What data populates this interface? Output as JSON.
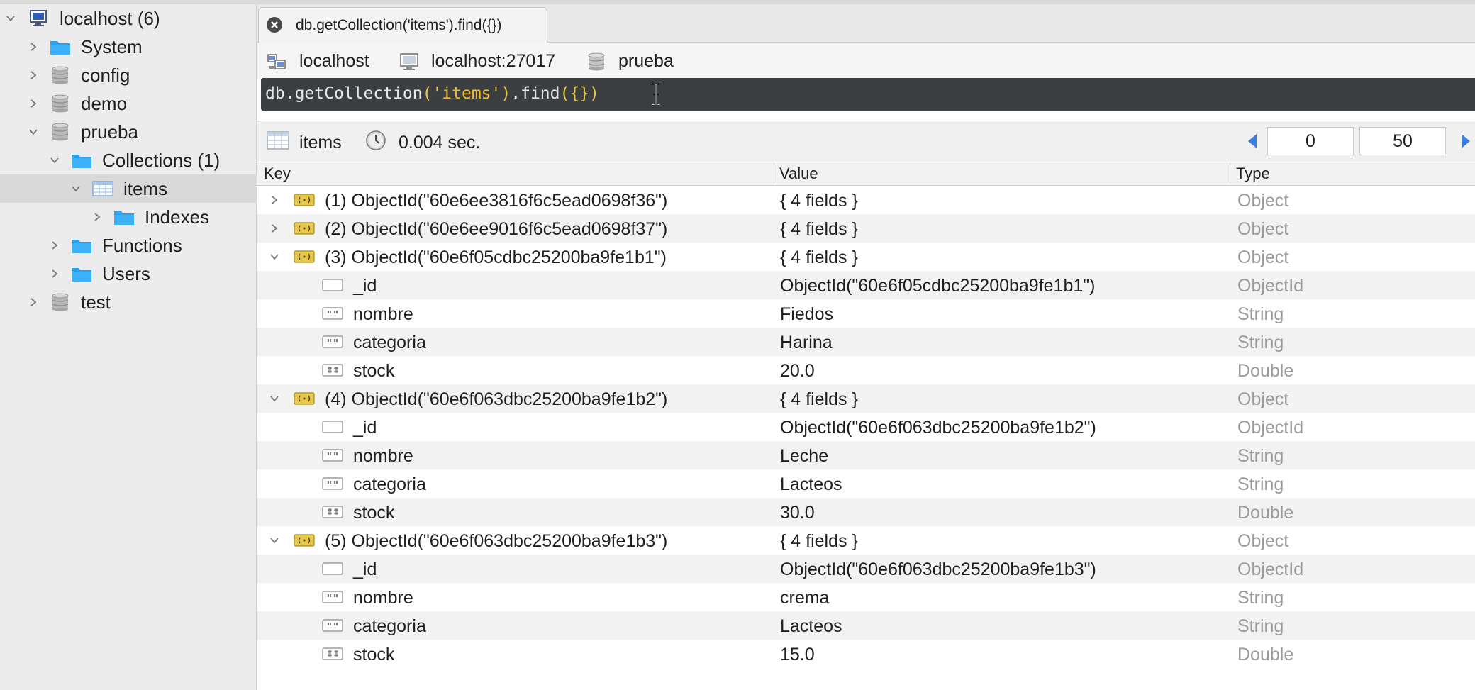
{
  "sidebar": {
    "items": [
      {
        "label": "localhost (6)",
        "icon": "server-icon"
      },
      {
        "label": "System",
        "icon": "folder-icon"
      },
      {
        "label": "config",
        "icon": "database-icon"
      },
      {
        "label": "demo",
        "icon": "database-icon"
      },
      {
        "label": "prueba",
        "icon": "database-icon"
      },
      {
        "label": "Collections (1)",
        "icon": "folder-icon"
      },
      {
        "label": "items",
        "icon": "collection-icon"
      },
      {
        "label": "Indexes",
        "icon": "folder-icon"
      },
      {
        "label": "Functions",
        "icon": "folder-icon"
      },
      {
        "label": "Users",
        "icon": "folder-icon"
      },
      {
        "label": "test",
        "icon": "database-icon"
      }
    ]
  },
  "tab": {
    "title": "db.getCollection('items').find({})"
  },
  "connection": {
    "host": "localhost",
    "server": "localhost:27017",
    "database": "prueba"
  },
  "query": {
    "db": "db",
    "dot1": ".",
    "fn": "getCollection",
    "open_paren": "(",
    "collection": "'items'",
    "close_paren": ")",
    "dot2": ".",
    "find": "find",
    "args": "({})"
  },
  "results": {
    "collection": "items",
    "time": "0.004 sec.",
    "skip": "0",
    "limit": "50"
  },
  "grid": {
    "headers": {
      "key": "Key",
      "value": "Value",
      "type": "Type"
    },
    "rows": [
      {
        "key": "(1) ObjectId(\"60e6ee3816f6c5ead0698f36\")",
        "value": "{ 4 fields }",
        "type": "Object"
      },
      {
        "key": "(2) ObjectId(\"60e6ee9016f6c5ead0698f37\")",
        "value": "{ 4 fields }",
        "type": "Object"
      },
      {
        "key": "(3) ObjectId(\"60e6f05cdbc25200ba9fe1b1\")",
        "value": "{ 4 fields }",
        "type": "Object"
      },
      {
        "key": "_id",
        "value": "ObjectId(\"60e6f05cdbc25200ba9fe1b1\")",
        "type": "ObjectId"
      },
      {
        "key": "nombre",
        "value": "Fiedos",
        "type": "String"
      },
      {
        "key": "categoria",
        "value": "Harina",
        "type": "String"
      },
      {
        "key": "stock",
        "value": "20.0",
        "type": "Double"
      },
      {
        "key": "(4) ObjectId(\"60e6f063dbc25200ba9fe1b2\")",
        "value": "{ 4 fields }",
        "type": "Object"
      },
      {
        "key": "_id",
        "value": "ObjectId(\"60e6f063dbc25200ba9fe1b2\")",
        "type": "ObjectId"
      },
      {
        "key": "nombre",
        "value": "Leche",
        "type": "String"
      },
      {
        "key": "categoria",
        "value": "Lacteos",
        "type": "String"
      },
      {
        "key": "stock",
        "value": "30.0",
        "type": "Double"
      },
      {
        "key": "(5) ObjectId(\"60e6f063dbc25200ba9fe1b3\")",
        "value": "{ 4 fields }",
        "type": "Object"
      },
      {
        "key": "_id",
        "value": "ObjectId(\"60e6f063dbc25200ba9fe1b3\")",
        "type": "ObjectId"
      },
      {
        "key": "nombre",
        "value": "crema",
        "type": "String"
      },
      {
        "key": "categoria",
        "value": "Lacteos",
        "type": "String"
      },
      {
        "key": "stock",
        "value": "15.0",
        "type": "Double"
      }
    ]
  }
}
